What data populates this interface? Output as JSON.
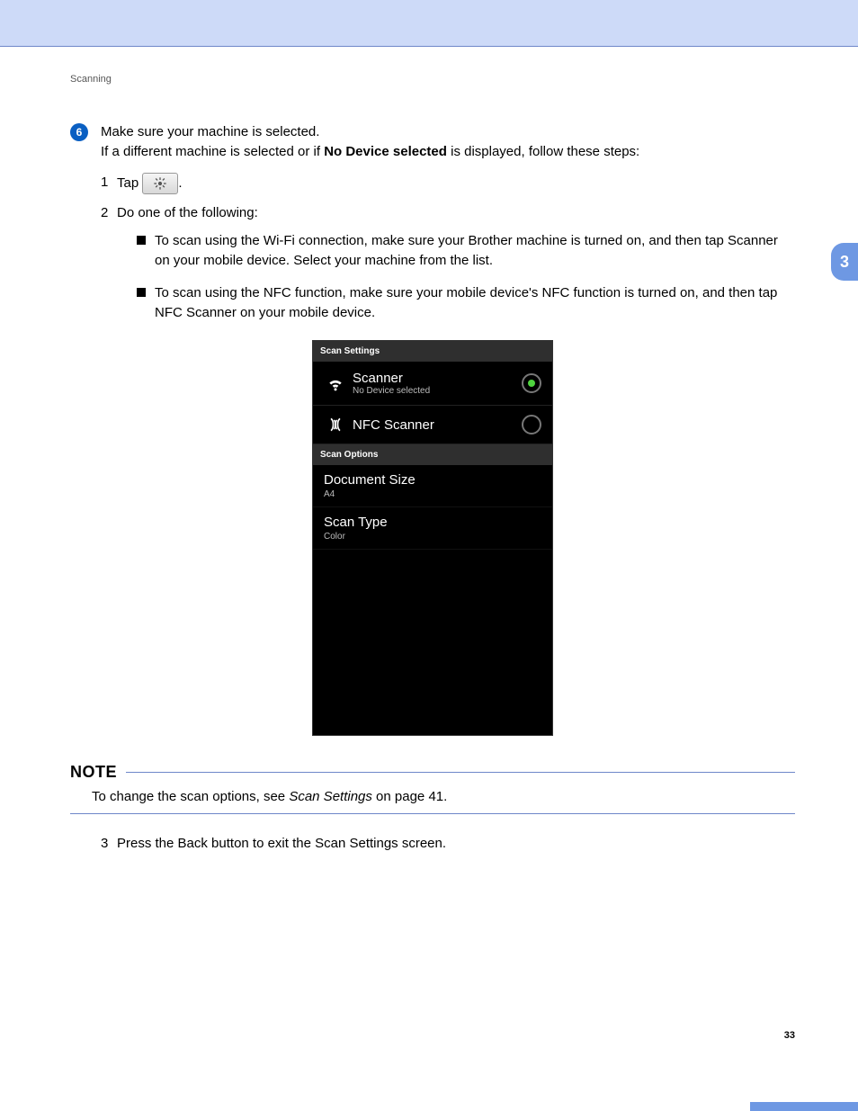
{
  "running_head": "Scanning",
  "chapter_tab": "3",
  "page_number": "33",
  "step": {
    "number": "6",
    "line1": "Make sure your machine is selected.",
    "line2a": "If a different machine is selected or if ",
    "line2b_bold": "No Device selected",
    "line2c": " is displayed, follow these steps:"
  },
  "sub": {
    "n1": "1",
    "t1a": "Tap ",
    "t1b": ".",
    "n2": "2",
    "t2": "Do one of the following:",
    "n3": "3",
    "t3": "Press the Back button to exit the Scan Settings screen."
  },
  "bullets": {
    "b1a": "To scan using the Wi-Fi connection, make sure your Brother machine is turned on, and then tap ",
    "b1b_bold": "Scanner",
    "b1c": " on your mobile device. Select your machine from the list.",
    "b2a": "To scan using the NFC function, make sure your mobile device's NFC function is turned on, and then tap ",
    "b2b_bold": "NFC Scanner",
    "b2c": " on your mobile device."
  },
  "phone": {
    "section1": "Scan Settings",
    "scanner": "Scanner",
    "scanner_sub": "No Device selected",
    "nfc": "NFC Scanner",
    "section2": "Scan Options",
    "docsize": "Document Size",
    "docsize_val": "A4",
    "scantype": "Scan Type",
    "scantype_val": "Color"
  },
  "note": {
    "label": "NOTE",
    "body_a": "To change the scan options, see ",
    "body_ital": "Scan Settings",
    "body_b": " on page 41."
  }
}
